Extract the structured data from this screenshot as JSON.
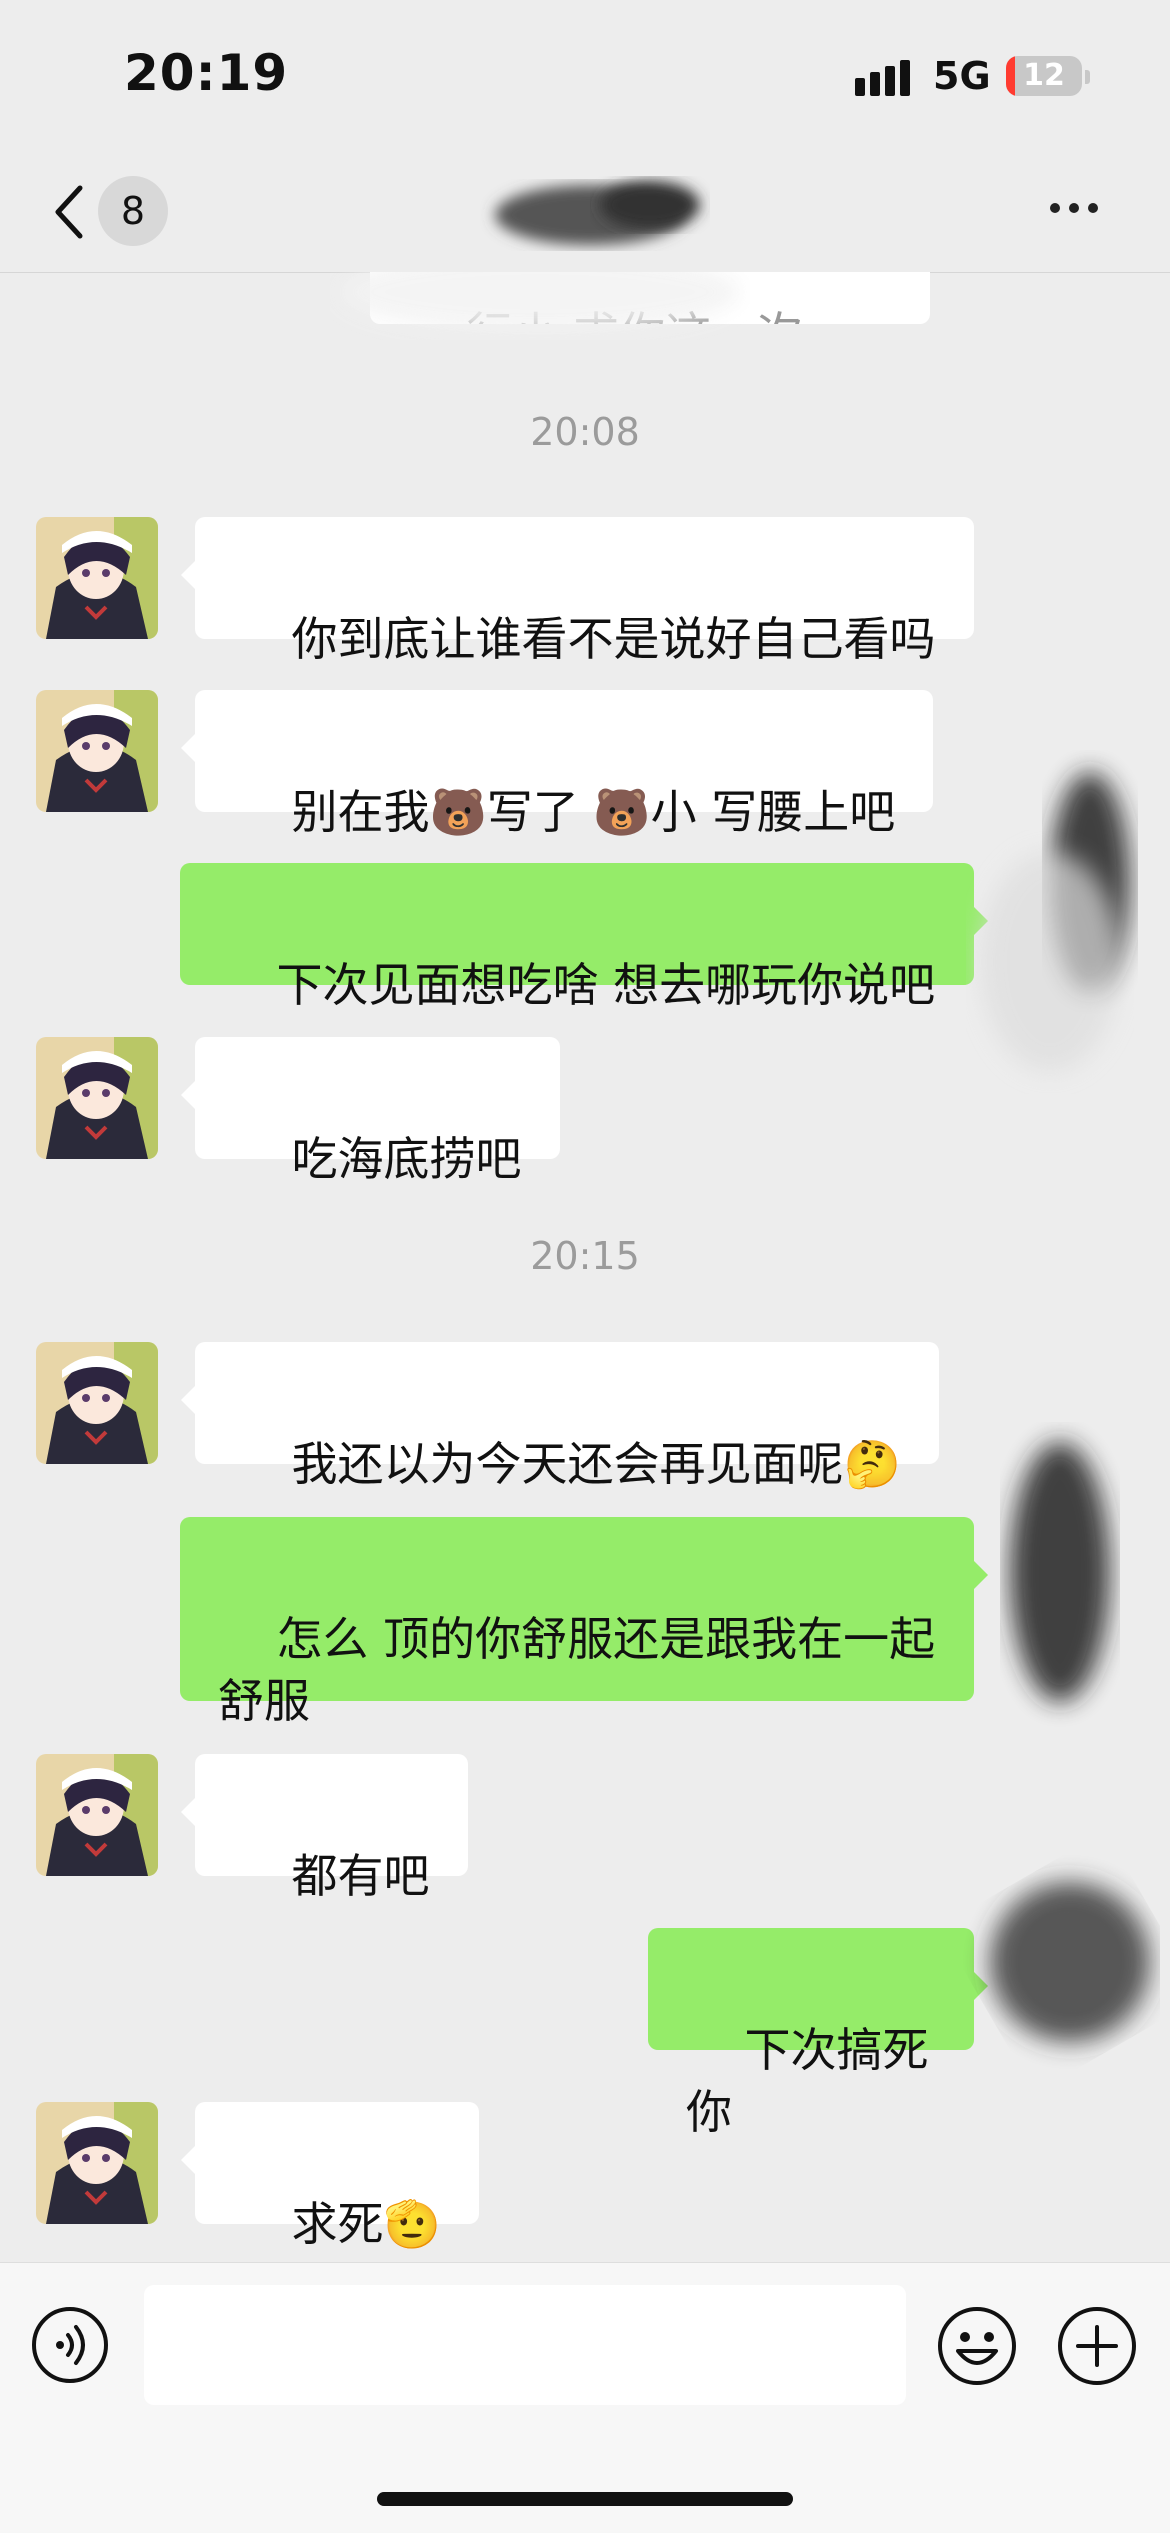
{
  "status_bar": {
    "time": "20:19",
    "network": "5G",
    "battery": "12",
    "battery_level": 0.12
  },
  "nav": {
    "unread_badge": "8"
  },
  "chat": {
    "partial_top_text": "行小 求你这一次。",
    "timestamps": [
      "20:08",
      "20:15"
    ],
    "messages": [
      {
        "side": "in",
        "text": "你到底让谁看不是说好自己看吗"
      },
      {
        "side": "in",
        "text": "别在我🐻写了 🐻小 写腰上吧"
      },
      {
        "side": "out",
        "text": "下次见面想吃啥 想去哪玩你说吧"
      },
      {
        "side": "in",
        "text": "吃海底捞吧"
      },
      {
        "side": "in",
        "text": "我还以为今天还会再见面呢🤔"
      },
      {
        "side": "out",
        "text": "怎么 顶的你舒服还是跟我在一起舒服"
      },
      {
        "side": "in",
        "text": "都有吧"
      },
      {
        "side": "out",
        "text": "下次搞死你"
      },
      {
        "side": "in",
        "text": "求死🫡"
      }
    ]
  },
  "input_bar": {
    "value": "",
    "placeholder": ""
  },
  "icons": {
    "back": "chevron-left-icon",
    "more": "more-icon",
    "voice": "voice-icon",
    "emoji": "emoji-icon",
    "plus": "plus-icon"
  },
  "colors": {
    "incoming_bubble": "#ffffff",
    "outgoing_bubble": "#95ec69",
    "background": "#ededed"
  }
}
